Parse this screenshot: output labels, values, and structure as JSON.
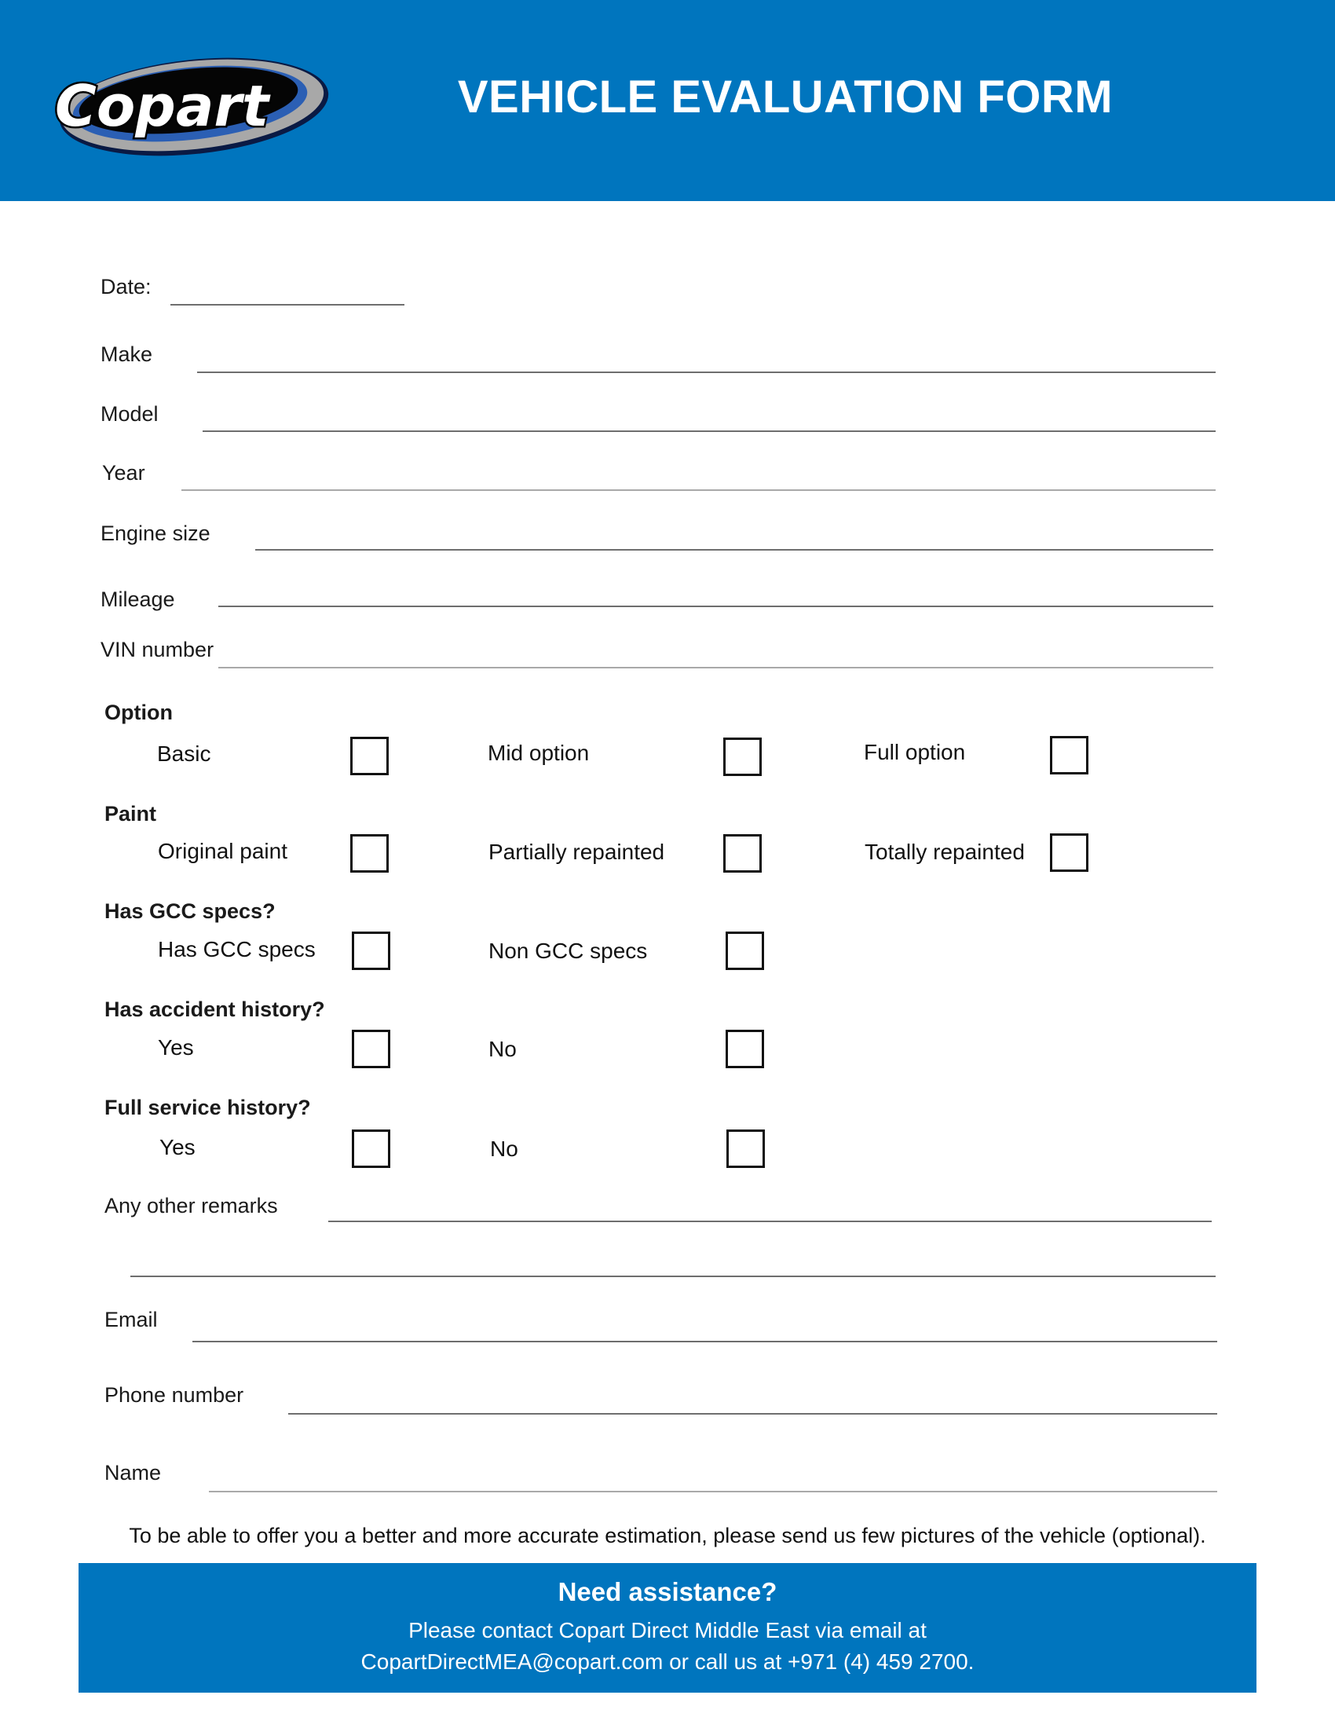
{
  "header": {
    "logo_text": "Copart",
    "title": "VEHICLE EVALUATION FORM",
    "brand_color": "#0075BE"
  },
  "fields": {
    "date": {
      "label": "Date:",
      "value": ""
    },
    "make": {
      "label": "Make",
      "value": ""
    },
    "model": {
      "label": "Model",
      "value": ""
    },
    "year": {
      "label": "Year",
      "value": ""
    },
    "engine_size": {
      "label": "Engine size",
      "value": ""
    },
    "mileage": {
      "label": "Mileage",
      "value": ""
    },
    "vin": {
      "label": "VIN number",
      "value": ""
    }
  },
  "groups": [
    {
      "heading": "Option",
      "options": [
        {
          "label": "Basic",
          "checked": false
        },
        {
          "label": "Mid option",
          "checked": false
        },
        {
          "label": "Full option",
          "checked": false
        }
      ]
    },
    {
      "heading": "Paint",
      "options": [
        {
          "label": "Original paint",
          "checked": false
        },
        {
          "label": "Partially repainted",
          "checked": false
        },
        {
          "label": "Totally repainted",
          "checked": false
        }
      ]
    },
    {
      "heading": "Has GCC specs?",
      "options": [
        {
          "label": "Has GCC specs",
          "checked": false
        },
        {
          "label": "Non GCC specs",
          "checked": false
        }
      ]
    },
    {
      "heading": "Has accident history?",
      "options": [
        {
          "label": "Yes",
          "checked": false
        },
        {
          "label": "No",
          "checked": false
        }
      ]
    },
    {
      "heading": "Full service history?",
      "options": [
        {
          "label": "Yes",
          "checked": false
        },
        {
          "label": "No",
          "checked": false
        }
      ]
    }
  ],
  "contact": {
    "remarks": {
      "label": "Any other remarks",
      "value": ""
    },
    "email": {
      "label": "Email",
      "value": ""
    },
    "phone": {
      "label": "Phone number",
      "value": ""
    },
    "name": {
      "label": "Name",
      "value": ""
    }
  },
  "note": "To be able to offer you a better and more accurate estimation, please send us few pictures of the vehicle (optional).",
  "footer": {
    "heading": "Need assistance?",
    "line1": "Please contact Copart Direct Middle East via email at",
    "email": "CopartDirectMEA@copart.com",
    "line2_suffix": " or call us at +971 (4) 459 2700."
  }
}
